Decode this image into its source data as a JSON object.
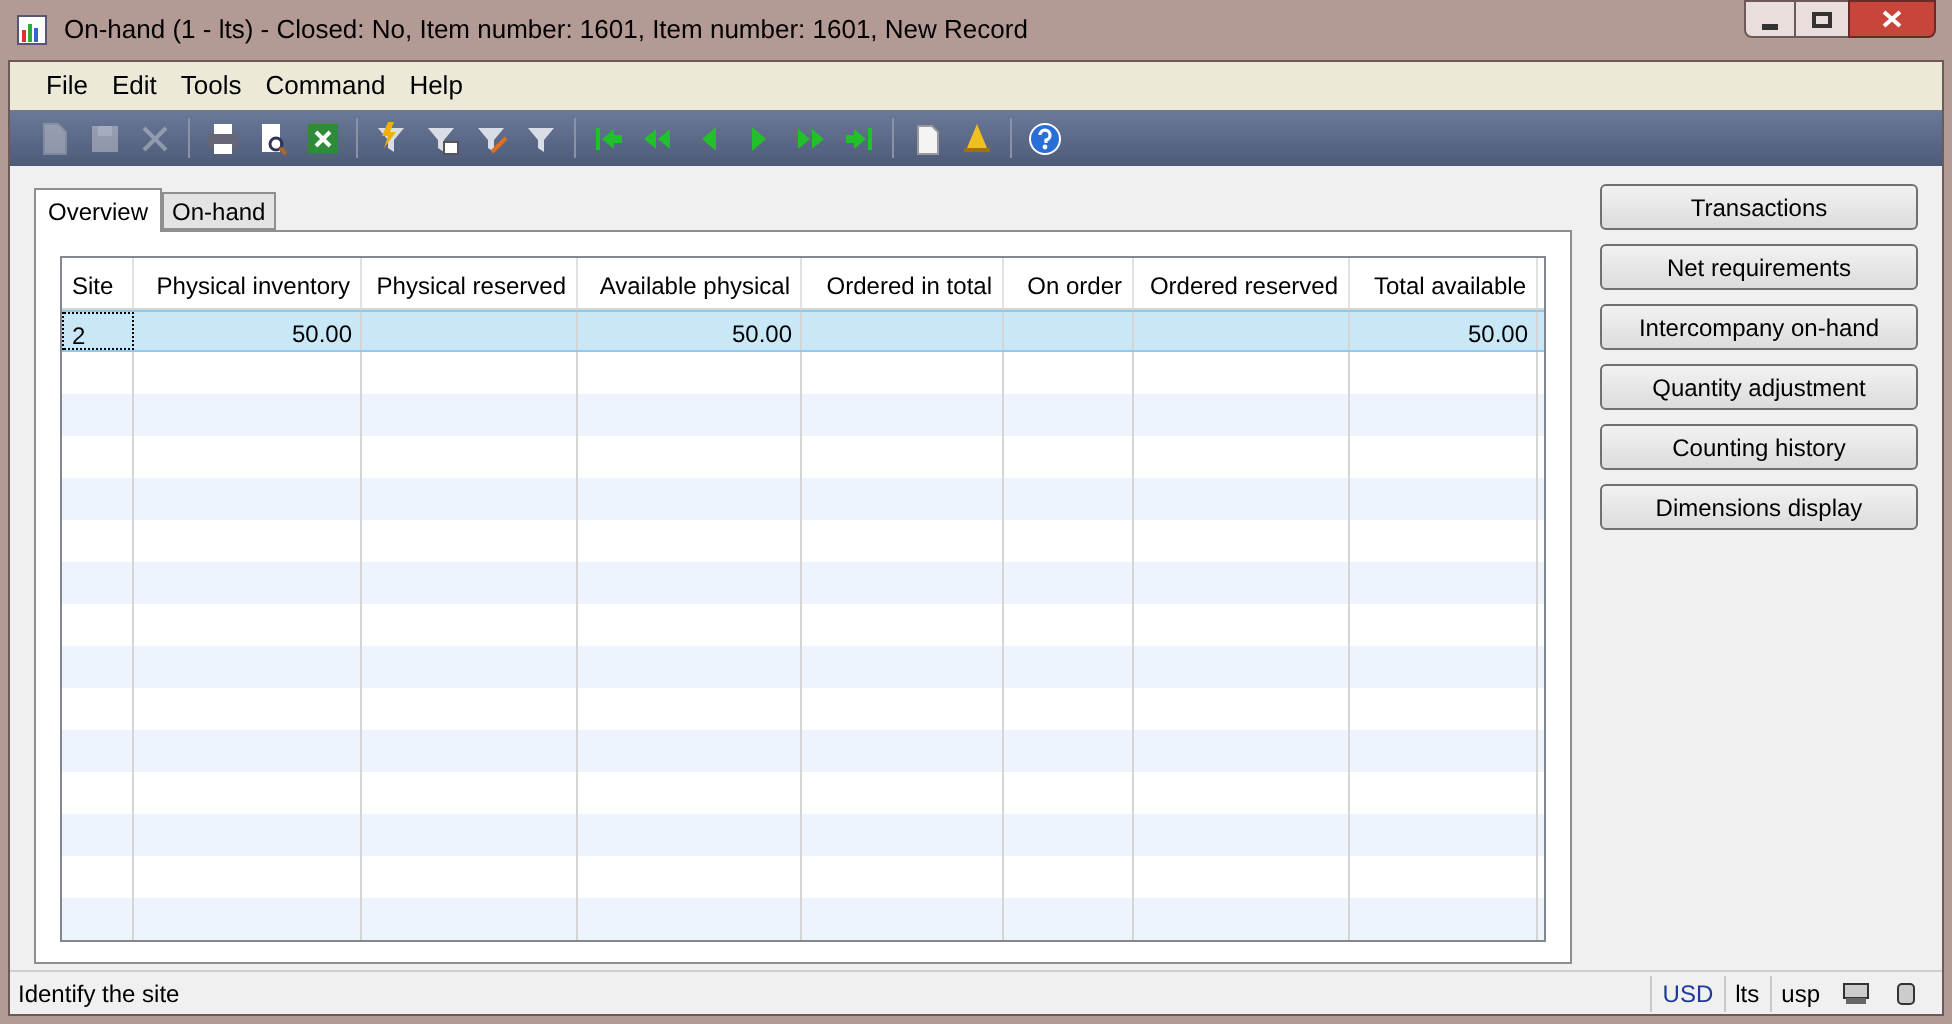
{
  "window": {
    "title": "On-hand (1 - lts) - Closed: No, Item number: 1601, Item number: 1601, New Record"
  },
  "menu": [
    "File",
    "Edit",
    "Tools",
    "Command",
    "Help"
  ],
  "toolbar": [
    {
      "kind": "new",
      "disabled": true
    },
    {
      "kind": "save",
      "disabled": true
    },
    {
      "kind": "delete",
      "disabled": true
    },
    {
      "kind": "sep"
    },
    {
      "kind": "print",
      "disabled": false
    },
    {
      "kind": "preview",
      "disabled": false
    },
    {
      "kind": "excel",
      "disabled": false
    },
    {
      "kind": "sep"
    },
    {
      "kind": "filter-quick",
      "disabled": false
    },
    {
      "kind": "filter-grid",
      "disabled": false
    },
    {
      "kind": "filter-edit",
      "disabled": false
    },
    {
      "kind": "filter-clear",
      "disabled": false
    },
    {
      "kind": "sep"
    },
    {
      "kind": "first",
      "disabled": false
    },
    {
      "kind": "prev-page",
      "disabled": false
    },
    {
      "kind": "prev",
      "disabled": false
    },
    {
      "kind": "next",
      "disabled": false
    },
    {
      "kind": "next-page",
      "disabled": false
    },
    {
      "kind": "last",
      "disabled": false
    },
    {
      "kind": "sep"
    },
    {
      "kind": "attach",
      "disabled": false
    },
    {
      "kind": "alert",
      "disabled": false
    },
    {
      "kind": "sep"
    },
    {
      "kind": "help",
      "disabled": false
    }
  ],
  "tabs": [
    {
      "label": "Overview",
      "selected": true
    },
    {
      "label": "On-hand",
      "selected": false
    }
  ],
  "table": {
    "columns": [
      "Site",
      "Physical inventory",
      "Physical reserved",
      "Available physical",
      "Ordered in total",
      "On order",
      "Ordered reserved",
      "Total available"
    ],
    "rows": [
      {
        "selected": true,
        "cells": [
          "2",
          "50.00",
          "",
          "50.00",
          "",
          "",
          "",
          "50.00"
        ]
      }
    ]
  },
  "buttons": [
    "Transactions",
    "Net requirements",
    "Intercompany on-hand",
    "Quantity adjustment",
    "Counting history",
    "Dimensions display"
  ],
  "status_bar": {
    "message": "Identify the site",
    "fields": [
      "USD",
      "lts",
      "usp"
    ]
  }
}
